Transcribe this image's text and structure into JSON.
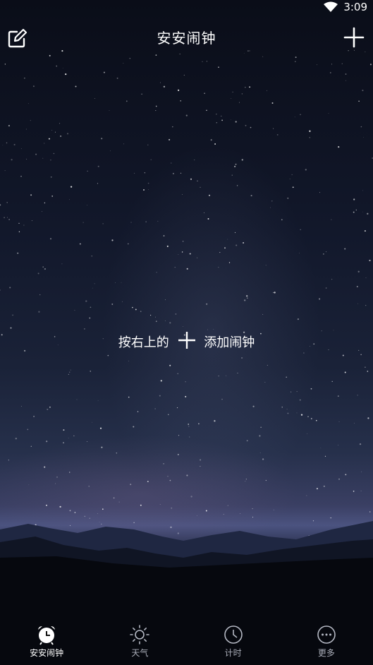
{
  "status": {
    "time": "3:09"
  },
  "header": {
    "title": "安安闹钟"
  },
  "hint": {
    "prefix": "按右上的",
    "suffix": "添加闹钟"
  },
  "tabs": [
    {
      "label": "安安闹钟",
      "icon": "alarm-clock-icon",
      "active": true
    },
    {
      "label": "天气",
      "icon": "sun-icon",
      "active": false
    },
    {
      "label": "计时",
      "icon": "clock-icon",
      "active": false
    },
    {
      "label": "更多",
      "icon": "more-icon",
      "active": false
    }
  ]
}
